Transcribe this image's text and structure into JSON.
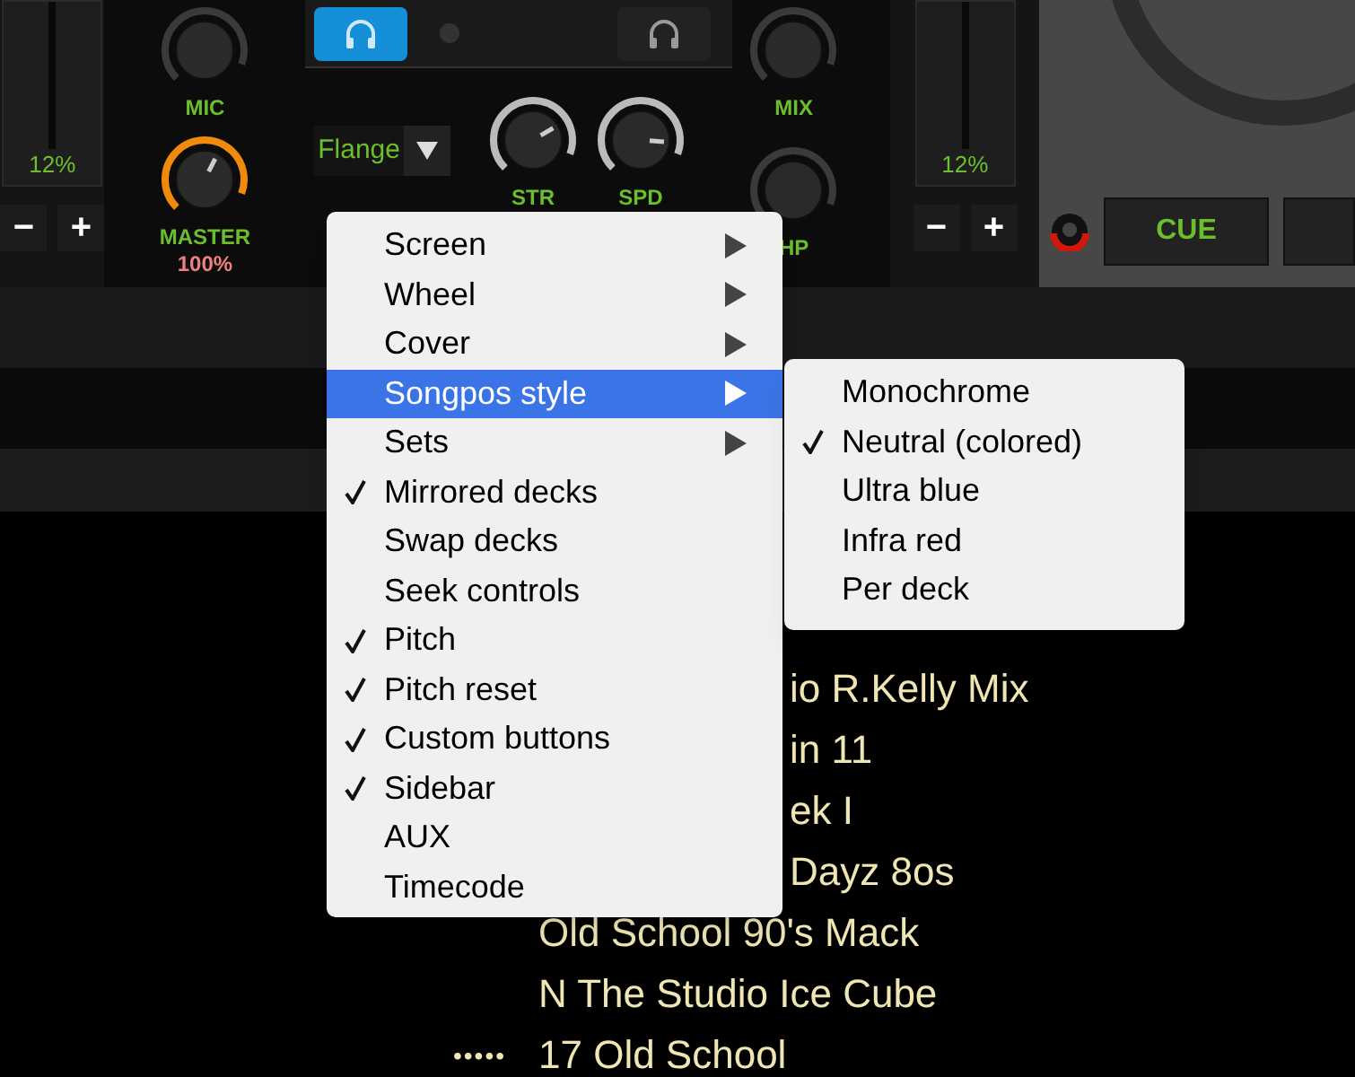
{
  "mixer": {
    "left_pitch": {
      "reading": "12%",
      "minus": "−",
      "plus": "+"
    },
    "mic": {
      "label": "MIC"
    },
    "master": {
      "label": "MASTER",
      "reading": "100%"
    },
    "headphones": [
      {
        "selected": true
      },
      {
        "selected": false
      }
    ],
    "effect": {
      "value": "Flange"
    },
    "fx_knobs": [
      {
        "label": "STR"
      },
      {
        "label": "SPD"
      }
    ],
    "mix_knobs": [
      {
        "label": "MIX"
      },
      {
        "label": "HP"
      }
    ],
    "right_pitch": {
      "reading": "12%",
      "minus": "−",
      "plus": "+"
    },
    "cue_button": "CUE"
  },
  "menu": {
    "items": [
      {
        "label": "Screen",
        "checked": false,
        "submenu": true,
        "selected": false
      },
      {
        "label": "Wheel",
        "checked": false,
        "submenu": true,
        "selected": false
      },
      {
        "label": "Cover",
        "checked": false,
        "submenu": true,
        "selected": false
      },
      {
        "label": "Songpos style",
        "checked": false,
        "submenu": true,
        "selected": true
      },
      {
        "label": "Sets",
        "checked": false,
        "submenu": true,
        "selected": false
      },
      {
        "label": "Mirrored decks",
        "checked": true,
        "submenu": false,
        "selected": false
      },
      {
        "label": "Swap decks",
        "checked": false,
        "submenu": false,
        "selected": false
      },
      {
        "label": "Seek controls",
        "checked": false,
        "submenu": false,
        "selected": false
      },
      {
        "label": "Pitch",
        "checked": true,
        "submenu": false,
        "selected": false
      },
      {
        "label": "Pitch reset",
        "checked": true,
        "submenu": false,
        "selected": false
      },
      {
        "label": "Custom buttons",
        "checked": true,
        "submenu": false,
        "selected": false
      },
      {
        "label": "Sidebar",
        "checked": true,
        "submenu": false,
        "selected": false
      },
      {
        "label": "AUX",
        "checked": false,
        "submenu": false,
        "selected": false
      },
      {
        "label": "Timecode",
        "checked": false,
        "submenu": false,
        "selected": false
      }
    ]
  },
  "submenu": {
    "items": [
      {
        "label": "Monochrome",
        "checked": false
      },
      {
        "label": "Neutral (colored)",
        "checked": true
      },
      {
        "label": "Ultra blue",
        "checked": false
      },
      {
        "label": "Infra red",
        "checked": false
      },
      {
        "label": "Per deck",
        "checked": false
      }
    ]
  },
  "tracks": [
    {
      "kind": "partial",
      "title": "io R.Kelly Mix"
    },
    {
      "kind": "partial",
      "title": "in 11"
    },
    {
      "kind": "partial",
      "title": "ek I"
    },
    {
      "kind": "partial",
      "title": "Dayz 8os"
    },
    {
      "kind": "full",
      "title": "Old School  90's Mack"
    },
    {
      "kind": "full",
      "title": "N The Studio Ice Cube"
    },
    {
      "kind": "full",
      "title": "17 Old School",
      "rating": "•••••"
    }
  ]
}
